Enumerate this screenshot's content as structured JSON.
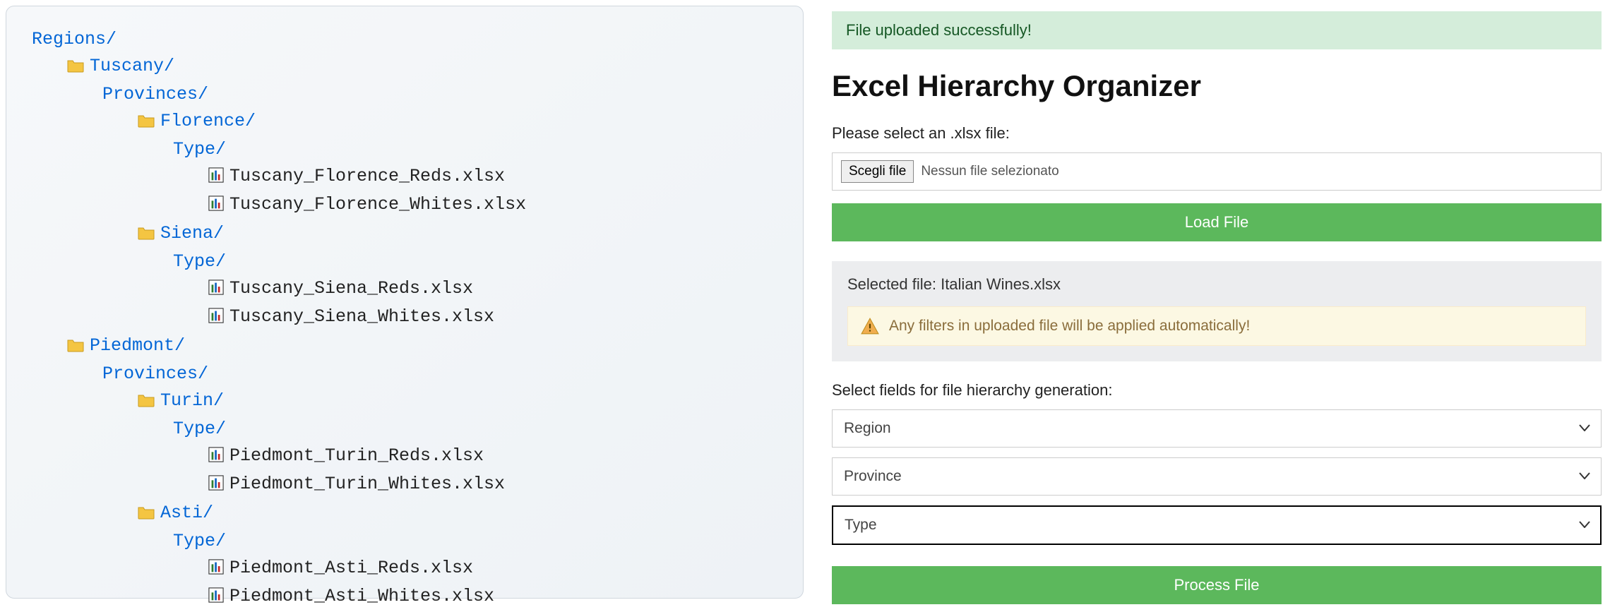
{
  "tree": {
    "root_label": "Regions/",
    "regions": [
      {
        "name": "Tuscany/",
        "subgroup_label": "Provinces/",
        "provinces": [
          {
            "name": "Florence/",
            "type_label": "Type/",
            "files": [
              "Tuscany_Florence_Reds.xlsx",
              "Tuscany_Florence_Whites.xlsx"
            ]
          },
          {
            "name": "Siena/",
            "type_label": "Type/",
            "files": [
              "Tuscany_Siena_Reds.xlsx",
              "Tuscany_Siena_Whites.xlsx"
            ]
          }
        ]
      },
      {
        "name": "Piedmont/",
        "subgroup_label": "Provinces/",
        "provinces": [
          {
            "name": "Turin/",
            "type_label": "Type/",
            "files": [
              "Piedmont_Turin_Reds.xlsx",
              "Piedmont_Turin_Whites.xlsx"
            ]
          },
          {
            "name": "Asti/",
            "type_label": "Type/",
            "files": [
              "Piedmont_Asti_Reds.xlsx",
              "Piedmont_Asti_Whites.xlsx"
            ]
          }
        ]
      }
    ]
  },
  "form": {
    "success_message": "File uploaded successfully!",
    "title": "Excel Hierarchy Organizer",
    "select_file_label": "Please select an .xlsx file:",
    "file_picker_button": "Scegli file",
    "file_picker_status": "Nessun file selezionato",
    "load_button": "Load File",
    "selected_file_prefix": "Selected file: ",
    "selected_file_name": "Italian Wines.xlsx",
    "warning_text": "Any filters in uploaded file will be applied automatically!",
    "hierarchy_label": "Select fields for file hierarchy generation:",
    "selects": [
      "Region",
      "Province",
      "Type"
    ],
    "active_select_index": 2,
    "process_button": "Process File"
  }
}
